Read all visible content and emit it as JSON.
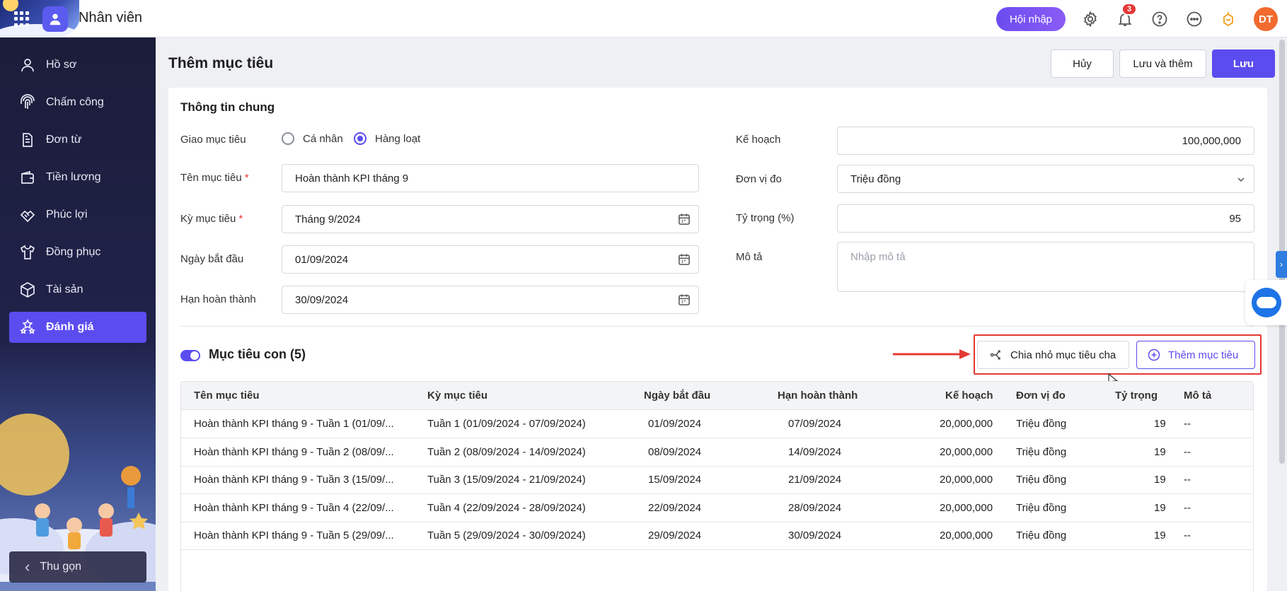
{
  "header": {
    "app_title": "Nhân viên",
    "onboard_label": "Hội nhập",
    "notification_count": "3",
    "avatar_initials": "DT",
    "accent_color": "#5b4cf0"
  },
  "sidebar": {
    "items": [
      {
        "label": "Hồ sơ",
        "icon": "person-icon"
      },
      {
        "label": "Chấm công",
        "icon": "fingerprint-icon"
      },
      {
        "label": "Đơn từ",
        "icon": "document-icon"
      },
      {
        "label": "Tiền lương",
        "icon": "wallet-icon"
      },
      {
        "label": "Phúc lợi",
        "icon": "handshake-icon"
      },
      {
        "label": "Đồng phục",
        "icon": "shirt-icon"
      },
      {
        "label": "Tài sản",
        "icon": "box-icon"
      },
      {
        "label": "Đánh giá",
        "icon": "stars-icon",
        "active": true
      }
    ],
    "collapse_label": "Thu gọn"
  },
  "page": {
    "title": "Thêm mục tiêu",
    "cancel_label": "Hủy",
    "save_add_label": "Lưu và thêm",
    "save_label": "Lưu"
  },
  "general": {
    "title": "Thông tin chung",
    "assign_label": "Giao mục tiêu",
    "assign_options": [
      "Cá nhân",
      "Hàng loạt"
    ],
    "assign_selected": "Hàng loạt",
    "name_label": "Tên mục tiêu",
    "name_value": "Hoàn thành KPI tháng 9",
    "period_label": "Kỳ mục tiêu",
    "period_value": "Tháng 9/2024",
    "start_label": "Ngày bắt đầu",
    "start_value": "01/09/2024",
    "deadline_label": "Hạn hoàn thành",
    "deadline_value": "30/09/2024",
    "plan_label": "Kế hoạch",
    "plan_value": "100,000,000",
    "unit_label": "Đơn vị đo",
    "unit_value": "Triệu đồng",
    "weight_label": "Tỷ trọng (%)",
    "weight_value": "95",
    "desc_label": "Mô tả",
    "desc_placeholder": "Nhập mô tả",
    "required_mark": "*"
  },
  "sub_goals": {
    "title": "Mục tiêu con (5)",
    "split_label": "Chia nhỏ mục tiêu cha",
    "add_label": "Thêm mục tiêu",
    "columns": [
      "Tên mục tiêu",
      "Kỳ mục tiêu",
      "Ngày bắt đầu",
      "Hạn hoàn thành",
      "Kế hoạch",
      "Đơn vị đo",
      "Tỷ trọng",
      "Mô tả"
    ],
    "rows": [
      [
        "Hoàn thành KPI tháng 9 - Tuần 1 (01/09/...",
        "Tuần 1 (01/09/2024 - 07/09/2024)",
        "01/09/2024",
        "07/09/2024",
        "20,000,000",
        "Triệu đồng",
        "19",
        "--"
      ],
      [
        "Hoàn thành KPI tháng 9 - Tuần 2 (08/09/...",
        "Tuần 2 (08/09/2024 - 14/09/2024)",
        "08/09/2024",
        "14/09/2024",
        "20,000,000",
        "Triệu đồng",
        "19",
        "--"
      ],
      [
        "Hoàn thành KPI tháng 9 - Tuần 3 (15/09/...",
        "Tuần 3 (15/09/2024 - 21/09/2024)",
        "15/09/2024",
        "21/09/2024",
        "20,000,000",
        "Triệu đồng",
        "19",
        "--"
      ],
      [
        "Hoàn thành KPI tháng 9 - Tuần 4 (22/09/...",
        "Tuần 4 (22/09/2024 - 28/09/2024)",
        "22/09/2024",
        "28/09/2024",
        "20,000,000",
        "Triệu đồng",
        "19",
        "--"
      ],
      [
        "Hoàn thành KPI tháng 9 - Tuần 5 (29/09/...",
        "Tuần 5 (29/09/2024 - 30/09/2024)",
        "29/09/2024",
        "30/09/2024",
        "20,000,000",
        "Triệu đồng",
        "19",
        "--"
      ]
    ]
  }
}
